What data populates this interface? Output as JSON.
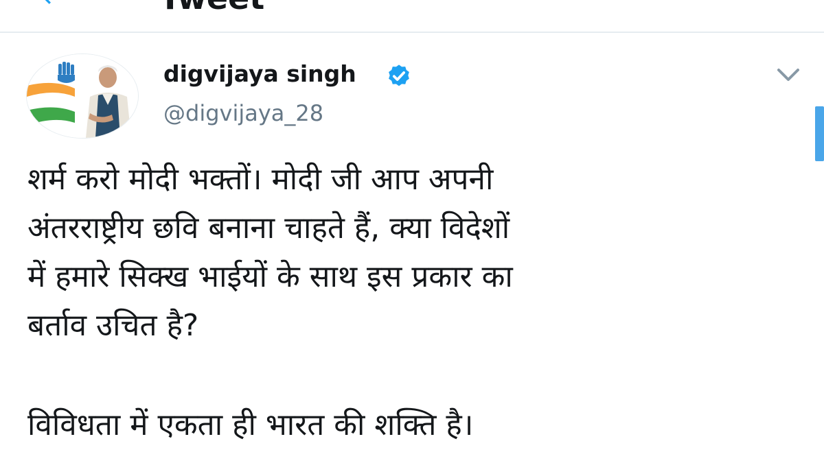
{
  "header": {
    "title": "Tweet",
    "back_icon": "back-arrow-icon"
  },
  "tweet": {
    "author": {
      "display_name": "digvijaya singh",
      "handle": "@digvijaya_28",
      "verified": true
    },
    "text_paragraph_1": "शर्म करो मोदी भक्तों। मोदी जी आप अपनी\nअंतरराष्ट्रीय छवि बनाना चाहते हैं, क्या विदेशों\nमें हमारे सिक्ख भाईयों के साथ इस प्रकार का\nबर्ताव उचित है?",
    "text_paragraph_2": "विविधता में एकता ही भारत की शक्ति है।"
  },
  "colors": {
    "accent": "#1da1f2",
    "text": "#14171a",
    "secondary_text": "#657786",
    "divider": "#e6ecf0"
  }
}
